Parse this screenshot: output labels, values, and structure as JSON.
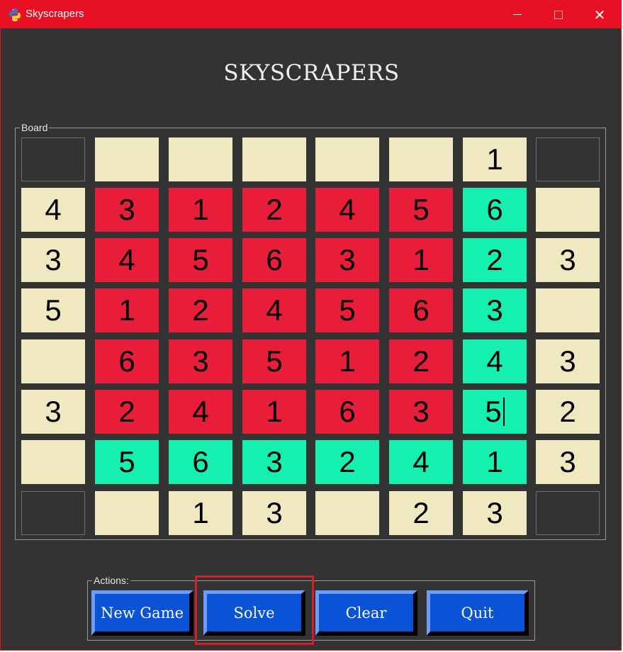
{
  "window": {
    "title": "Skyscrapers"
  },
  "heading": "SKYSCRAPERS",
  "board": {
    "label": "Board",
    "top_clues": [
      "",
      "",
      "",
      "",
      "",
      "1"
    ],
    "bottom_clues": [
      "",
      "1",
      "3",
      "",
      "2",
      "3"
    ],
    "left_clues": [
      "4",
      "3",
      "5",
      "",
      "3",
      ""
    ],
    "right_clues": [
      "",
      "3",
      "",
      "3",
      "2",
      "3"
    ],
    "grid": [
      [
        "3",
        "1",
        "2",
        "4",
        "5",
        "6"
      ],
      [
        "4",
        "5",
        "6",
        "3",
        "1",
        "2"
      ],
      [
        "1",
        "2",
        "4",
        "5",
        "6",
        "3"
      ],
      [
        "6",
        "3",
        "5",
        "1",
        "2",
        "4"
      ],
      [
        "2",
        "4",
        "1",
        "6",
        "3",
        "5"
      ],
      [
        "5",
        "6",
        "3",
        "2",
        "4",
        "1"
      ]
    ],
    "cell_states": [
      [
        "red",
        "red",
        "red",
        "red",
        "red",
        "green"
      ],
      [
        "red",
        "red",
        "red",
        "red",
        "red",
        "green"
      ],
      [
        "red",
        "red",
        "red",
        "red",
        "red",
        "green"
      ],
      [
        "red",
        "red",
        "red",
        "red",
        "red",
        "green"
      ],
      [
        "red",
        "red",
        "red",
        "red",
        "red",
        "green"
      ],
      [
        "green",
        "green",
        "green",
        "green",
        "green",
        "green"
      ]
    ],
    "colors": {
      "clue_bg": "#f0e8c0",
      "red": "#e81d3a",
      "green": "#15f0b0",
      "empty": "#333333"
    }
  },
  "actions": {
    "label": "Actions:",
    "buttons": [
      "New Game",
      "Solve",
      "Clear",
      "Quit"
    ],
    "highlighted": "Solve"
  },
  "colors": {
    "titlebar": "#e81123",
    "background": "#333333",
    "button": "#0a52d6"
  }
}
